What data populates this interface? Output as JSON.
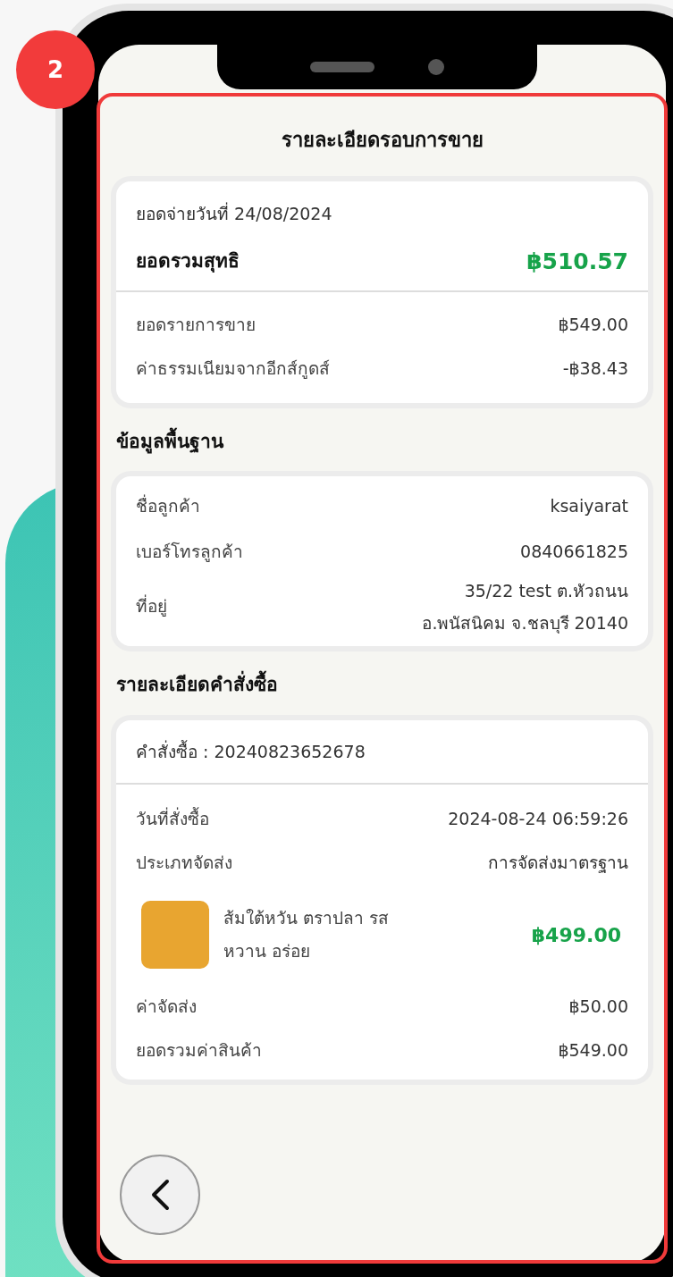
{
  "step_badge": "2",
  "screen": {
    "title": "รายละเอียดรอบการขาย",
    "summary": {
      "date_label": "ยอดจ่ายวันที่ 24/08/2024",
      "net_label": "ยอดรวมสุทธิ",
      "net_value": "฿510.57",
      "rows": [
        {
          "label": "ยอดรายการขาย",
          "value": "฿549.00"
        },
        {
          "label": "ค่าธรรมเนียมจากอีกส์กูดส์",
          "value": "-฿38.43"
        }
      ]
    },
    "basic_info": {
      "heading": "ข้อมูลพื้นฐาน",
      "rows": [
        {
          "label": "ชื่อลูกค้า",
          "value_lines": [
            "ksaiyarat"
          ]
        },
        {
          "label": "เบอร์โทรลูกค้า",
          "value_lines": [
            "0840661825"
          ]
        },
        {
          "label": "ที่อยู่",
          "value_lines": [
            "35/22 test ต.หัวถนน",
            "อ.พนัสนิคม จ.ชลบุรี 20140"
          ]
        }
      ]
    },
    "order": {
      "heading": "รายละเอียดคำสั่งซื้อ",
      "order_number": "คำสั่งซื้อ : 20240823652678",
      "rows": [
        {
          "label": "วันที่สั่งซื้อ",
          "value": "2024-08-24 06:59:26"
        },
        {
          "label": "ประเภทจัดส่ง",
          "value": "การจัดส่งมาตรฐาน"
        }
      ],
      "item": {
        "name_lines": [
          "ส้มใต้หวัน ตราปลา รส",
          "หวาน อร่อย"
        ],
        "price": "฿499.00"
      },
      "totals": [
        {
          "label": "ค่าจัดส่ง",
          "value": "฿50.00"
        },
        {
          "label": "ยอดรวมค่าสินค้า",
          "value": "฿549.00"
        }
      ]
    }
  }
}
